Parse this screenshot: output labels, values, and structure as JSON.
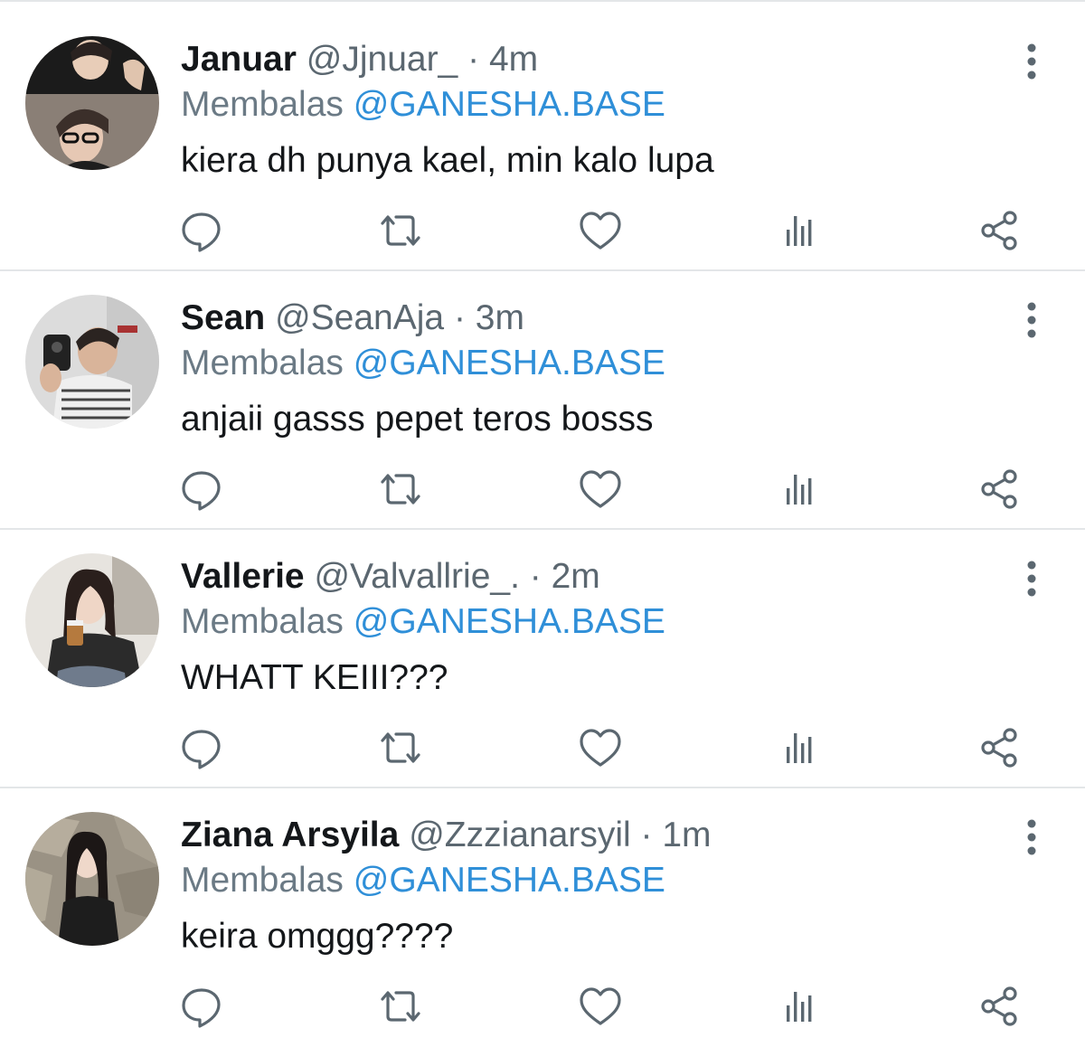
{
  "reply_prefix": "Membalas",
  "colors": {
    "link": "#2f8fd8",
    "secondary_text": "#5b6770",
    "icon": "#5b6770",
    "divider": "#e3e6e8"
  },
  "action_icons": [
    "reply-icon",
    "retweet-icon",
    "like-icon",
    "views-icon",
    "share-icon"
  ],
  "tweets": [
    {
      "name": "Januar",
      "handle": "@Jjnuar_",
      "time": "4m",
      "reply_to": "@GANESHA.BASE",
      "text": "kiera dh punya kael, min kalo lupa"
    },
    {
      "name": "Sean",
      "handle": "@SeanAja",
      "time": "3m",
      "reply_to": "@GANESHA.BASE",
      "text": "anjaii gasss pepet teros bosss"
    },
    {
      "name": "Vallerie",
      "handle": "@Valvallrie_.",
      "time": "2m",
      "reply_to": "@GANESHA.BASE",
      "text": "WHATT KEIII???"
    },
    {
      "name": "Ziana Arsyila",
      "handle": "@Zzzianarsyil",
      "time": "1m",
      "reply_to": "@GANESHA.BASE",
      "text": "keira omggg????"
    }
  ]
}
